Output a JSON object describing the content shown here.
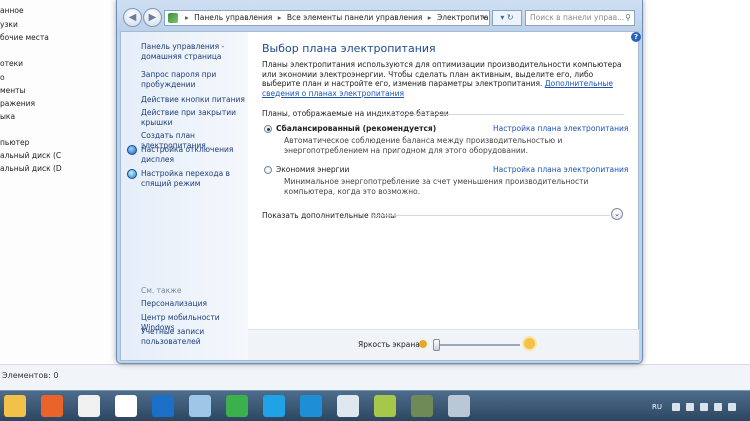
{
  "background": {
    "sidebar_items": [
      "анное",
      "узки",
      "бочие места",
      "",
      "отеки",
      "о",
      "менты",
      "ражения",
      "ыка",
      "",
      "пьютер",
      "альный диск (С",
      "альный диск (D"
    ],
    "status": "Элементов: 0"
  },
  "address": {
    "crumbs": [
      "Панель управления",
      "Все элементы панели управления",
      "Электропитание"
    ],
    "search_placeholder": "Поиск в панели управ..."
  },
  "sidebar": {
    "links": [
      {
        "label": "Панель управления - домашняя страница",
        "icon": null
      },
      {
        "label": "Запрос пароля при пробуждении",
        "icon": null
      },
      {
        "label": "Действие кнопки питания",
        "icon": null
      },
      {
        "label": "Действие при закрытии крышки",
        "icon": null
      },
      {
        "label": "Создать план электропитания",
        "icon": null
      },
      {
        "label": "Настройка отключения дисплея",
        "icon": "display-icon"
      },
      {
        "label": "Настройка перехода в спящий режим",
        "icon": "sleep-globe-icon"
      }
    ],
    "see_also_title": "См. также",
    "see_also": [
      "Персонализация",
      "Центр мобильности Windows",
      "Учетные записи пользователей"
    ]
  },
  "main": {
    "heading": "Выбор плана электропитания",
    "description": "Планы электропитания используются для оптимизации производительности компьютера или экономии электроэнергии. Чтобы сделать план активным, выделите его, либо выберите план и настройте его, изменив параметры электропитания.",
    "description_link": "Дополнительные сведения о планах электропитания",
    "section_title": "Планы, отображаемые на индикаторе батареи",
    "plans": [
      {
        "name": "Сбалансированный (рекомендуется)",
        "selected": true,
        "link": "Настройка плана электропитания",
        "desc": "Автоматическое соблюдение баланса между производительностью и энергопотреблением на пригодном для этого оборудовании."
      },
      {
        "name": "Экономия энергии",
        "selected": false,
        "link": "Настройка плана электропитания",
        "desc": "Минимальное энергопотребление за счет уменьшения производительности компьютера, когда это возможно."
      }
    ],
    "more_plans": "Показать дополнительные планы",
    "brightness_label": "Яркость экрана:",
    "brightness_level": 0.02
  },
  "taskbar": {
    "lang": "RU",
    "icons": [
      "explorer-icon",
      "media-player-icon",
      "documents-icon",
      "yandex-icon",
      "teamviewer-icon",
      "app-icon",
      "chrome-icon",
      "skype-icon",
      "arrow-app-icon",
      "user-app-icon",
      "notes-icon",
      "camera-icon",
      "window-icon"
    ],
    "colors": [
      "#f2c14a",
      "#e9632b",
      "#f0f0f0",
      "#ffffff",
      "#1b6fc7",
      "#9ec6e6",
      "#3cb04c",
      "#20a3e6",
      "#1e8fd6",
      "#dfe8ef",
      "#a6c84a",
      "#6f8a56",
      "#b9c7d6"
    ]
  }
}
